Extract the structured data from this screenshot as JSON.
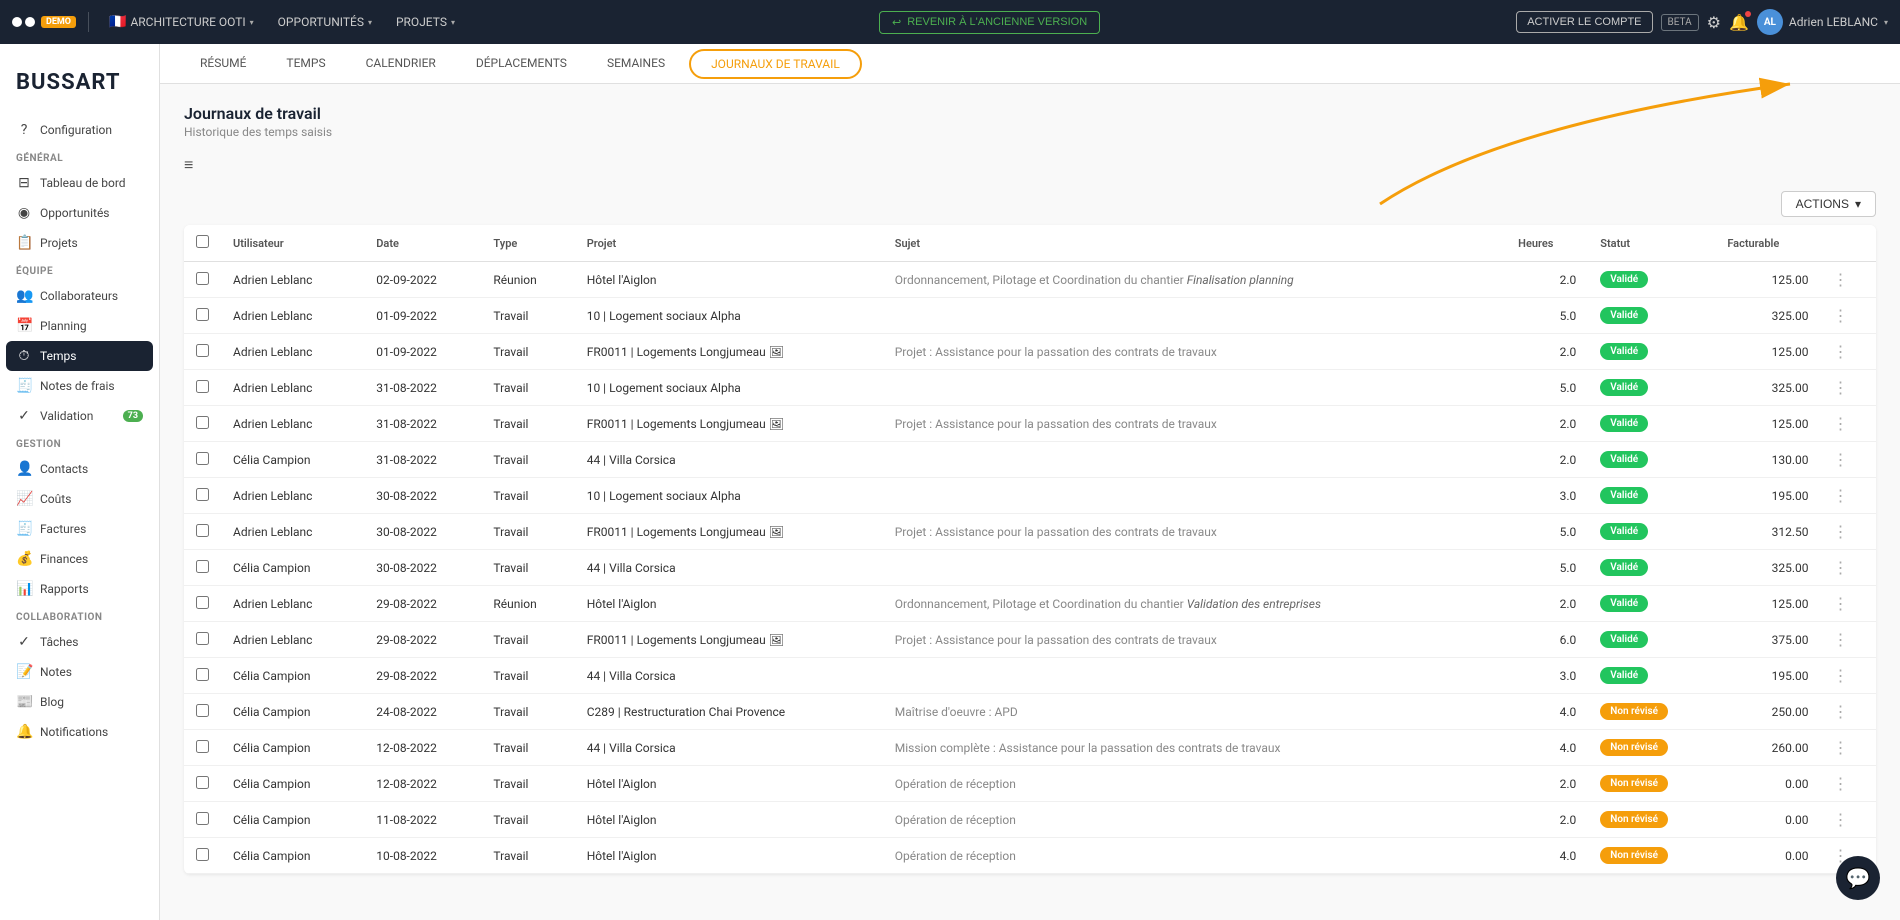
{
  "app": {
    "logo_label": "OOTI",
    "demo_badge": "DEMO",
    "beta_badge": "BETA"
  },
  "top_nav": {
    "items": [
      {
        "label": "ARCHITECTURE OOTI",
        "has_flag": true,
        "flag": "🇫🇷"
      },
      {
        "label": "OPPORTUNITÉS"
      },
      {
        "label": "PROJETS"
      }
    ],
    "revenir_btn": "REVENIR À L'ANCIENNE VERSION",
    "activer_btn": "ACTIVER LE COMPTE",
    "user_name": "Adrien LEBLANC",
    "user_initials": "AL"
  },
  "secondary_nav": {
    "tabs": [
      {
        "label": "RÉSUMÉ",
        "active": false
      },
      {
        "label": "TEMPS",
        "active": false
      },
      {
        "label": "CALENDRIER",
        "active": false
      },
      {
        "label": "DÉPLACEMENTS",
        "active": false
      },
      {
        "label": "SEMAINES",
        "active": false
      },
      {
        "label": "JOURNAUX DE TRAVAIL",
        "active": true
      }
    ]
  },
  "sidebar": {
    "brand": "BUSSART",
    "config_label": "Configuration",
    "sections": [
      {
        "title": "GÉNÉRAL",
        "items": [
          {
            "icon": "⊟",
            "label": "Tableau de bord",
            "active": false
          },
          {
            "icon": "◉",
            "label": "Opportunités",
            "active": false
          },
          {
            "icon": "📋",
            "label": "Projets",
            "active": false
          }
        ]
      },
      {
        "title": "ÉQUIPE",
        "items": [
          {
            "icon": "👥",
            "label": "Collaborateurs",
            "active": false
          },
          {
            "icon": "📅",
            "label": "Planning",
            "active": false
          },
          {
            "icon": "⏱",
            "label": "Temps",
            "active": true
          },
          {
            "icon": "🧾",
            "label": "Notes de frais",
            "active": false
          },
          {
            "icon": "✓",
            "label": "Validation",
            "active": false,
            "badge": "73"
          }
        ]
      },
      {
        "title": "GESTION",
        "items": [
          {
            "icon": "👤",
            "label": "Contacts",
            "active": false
          },
          {
            "icon": "📈",
            "label": "Coûts",
            "active": false
          },
          {
            "icon": "🧾",
            "label": "Factures",
            "active": false
          },
          {
            "icon": "💰",
            "label": "Finances",
            "active": false
          },
          {
            "icon": "📊",
            "label": "Rapports",
            "active": false
          }
        ]
      },
      {
        "title": "COLLABORATION",
        "items": [
          {
            "icon": "✓",
            "label": "Tâches",
            "active": false
          },
          {
            "icon": "📝",
            "label": "Notes",
            "active": false
          },
          {
            "icon": "📰",
            "label": "Blog",
            "active": false
          },
          {
            "icon": "🔔",
            "label": "Notifications",
            "active": false
          }
        ]
      }
    ]
  },
  "page": {
    "title": "Journaux de travail",
    "subtitle": "Historique des temps saisis",
    "actions_label": "ACTIONS",
    "actions_arrow": "▾"
  },
  "table": {
    "columns": [
      {
        "key": "checkbox",
        "label": ""
      },
      {
        "key": "utilisateur",
        "label": "Utilisateur"
      },
      {
        "key": "date",
        "label": "Date"
      },
      {
        "key": "type",
        "label": "Type"
      },
      {
        "key": "projet",
        "label": "Projet"
      },
      {
        "key": "sujet",
        "label": "Sujet"
      },
      {
        "key": "heures",
        "label": "Heures"
      },
      {
        "key": "statut",
        "label": "Statut"
      },
      {
        "key": "facturable",
        "label": "Facturable"
      },
      {
        "key": "actions",
        "label": ""
      }
    ],
    "rows": [
      {
        "utilisateur": "Adrien Leblanc",
        "date": "02-09-2022",
        "type": "Réunion",
        "projet": "Hôtel l'Aiglon",
        "sujet": "Ordonnancement, Pilotage et Coordination du chantier",
        "sujet_italic": "Finalisation planning",
        "heures": "2.0",
        "statut": "Validé",
        "statut_type": "valide",
        "facturable": "125.00"
      },
      {
        "utilisateur": "Adrien Leblanc",
        "date": "01-09-2022",
        "type": "Travail",
        "projet": "10 | Logement sociaux Alpha",
        "sujet": "",
        "sujet_italic": "",
        "heures": "5.0",
        "statut": "Validé",
        "statut_type": "valide",
        "facturable": "325.00"
      },
      {
        "utilisateur": "Adrien Leblanc",
        "date": "01-09-2022",
        "type": "Travail",
        "projet": "FR0011 | Logements Longjumeau 🖼",
        "sujet": "Projet : Assistance pour la passation des contrats de travaux",
        "sujet_italic": "",
        "heures": "2.0",
        "statut": "Validé",
        "statut_type": "valide",
        "facturable": "125.00"
      },
      {
        "utilisateur": "Adrien Leblanc",
        "date": "31-08-2022",
        "type": "Travail",
        "projet": "10 | Logement sociaux Alpha",
        "sujet": "",
        "sujet_italic": "",
        "heures": "5.0",
        "statut": "Validé",
        "statut_type": "valide",
        "facturable": "325.00"
      },
      {
        "utilisateur": "Adrien Leblanc",
        "date": "31-08-2022",
        "type": "Travail",
        "projet": "FR0011 | Logements Longjumeau 🖼",
        "sujet": "Projet : Assistance pour la passation des contrats de travaux",
        "sujet_italic": "",
        "heures": "2.0",
        "statut": "Validé",
        "statut_type": "valide",
        "facturable": "125.00"
      },
      {
        "utilisateur": "Célia Campion",
        "date": "31-08-2022",
        "type": "Travail",
        "projet": "44 | Villa Corsica",
        "sujet": "",
        "sujet_italic": "",
        "heures": "2.0",
        "statut": "Validé",
        "statut_type": "valide",
        "facturable": "130.00"
      },
      {
        "utilisateur": "Adrien Leblanc",
        "date": "30-08-2022",
        "type": "Travail",
        "projet": "10 | Logement sociaux Alpha",
        "sujet": "",
        "sujet_italic": "",
        "heures": "3.0",
        "statut": "Validé",
        "statut_type": "valide",
        "facturable": "195.00"
      },
      {
        "utilisateur": "Adrien Leblanc",
        "date": "30-08-2022",
        "type": "Travail",
        "projet": "FR0011 | Logements Longjumeau 🖼",
        "sujet": "Projet : Assistance pour la passation des contrats de travaux",
        "sujet_italic": "",
        "heures": "5.0",
        "statut": "Validé",
        "statut_type": "valide",
        "facturable": "312.50"
      },
      {
        "utilisateur": "Célia Campion",
        "date": "30-08-2022",
        "type": "Travail",
        "projet": "44 | Villa Corsica",
        "sujet": "",
        "sujet_italic": "",
        "heures": "5.0",
        "statut": "Validé",
        "statut_type": "valide",
        "facturable": "325.00"
      },
      {
        "utilisateur": "Adrien Leblanc",
        "date": "29-08-2022",
        "type": "Réunion",
        "projet": "Hôtel l'Aiglon",
        "sujet": "Ordonnancement, Pilotage et Coordination du chantier",
        "sujet_italic": "Validation des entreprises",
        "heures": "2.0",
        "statut": "Validé",
        "statut_type": "valide",
        "facturable": "125.00"
      },
      {
        "utilisateur": "Adrien Leblanc",
        "date": "29-08-2022",
        "type": "Travail",
        "projet": "FR0011 | Logements Longjumeau 🖼",
        "sujet": "Projet : Assistance pour la passation des contrats de travaux",
        "sujet_italic": "",
        "heures": "6.0",
        "statut": "Validé",
        "statut_type": "valide",
        "facturable": "375.00"
      },
      {
        "utilisateur": "Célia Campion",
        "date": "29-08-2022",
        "type": "Travail",
        "projet": "44 | Villa Corsica",
        "sujet": "",
        "sujet_italic": "",
        "heures": "3.0",
        "statut": "Validé",
        "statut_type": "valide",
        "facturable": "195.00"
      },
      {
        "utilisateur": "Célia Campion",
        "date": "24-08-2022",
        "type": "Travail",
        "projet": "C289 | Restructuration Chai Provence",
        "sujet": "Maîtrise d'oeuvre : APD",
        "sujet_italic": "",
        "heures": "4.0",
        "statut": "Non révisé",
        "statut_type": "nonrevise",
        "facturable": "250.00"
      },
      {
        "utilisateur": "Célia Campion",
        "date": "12-08-2022",
        "type": "Travail",
        "projet": "44 | Villa Corsica",
        "sujet": "Mission complète : Assistance pour la passation des contrats de travaux",
        "sujet_italic": "",
        "heures": "4.0",
        "statut": "Non révisé",
        "statut_type": "nonrevise",
        "facturable": "260.00"
      },
      {
        "utilisateur": "Célia Campion",
        "date": "12-08-2022",
        "type": "Travail",
        "projet": "Hôtel l'Aiglon",
        "sujet": "Opération de réception",
        "sujet_italic": "",
        "heures": "2.0",
        "statut": "Non révisé",
        "statut_type": "nonrevise",
        "facturable": "0.00"
      },
      {
        "utilisateur": "Célia Campion",
        "date": "11-08-2022",
        "type": "Travail",
        "projet": "Hôtel l'Aiglon",
        "sujet": "Opération de réception",
        "sujet_italic": "",
        "heures": "2.0",
        "statut": "Non révisé",
        "statut_type": "nonrevise",
        "facturable": "0.00"
      },
      {
        "utilisateur": "Célia Campion",
        "date": "10-08-2022",
        "type": "Travail",
        "projet": "Hôtel l'Aiglon",
        "sujet": "Opération de réception",
        "sujet_italic": "",
        "heures": "4.0",
        "statut": "Non révisé",
        "statut_type": "nonrevise",
        "facturable": "0.00"
      }
    ]
  }
}
